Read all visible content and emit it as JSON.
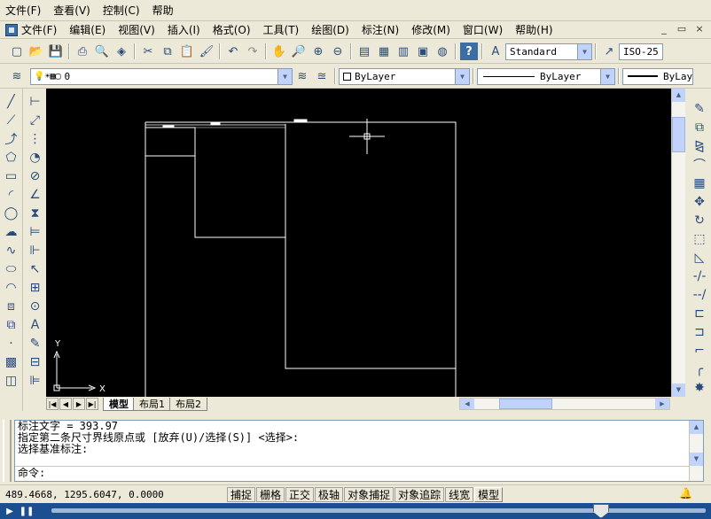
{
  "outer_menu": [
    "文件(F)",
    "查看(V)",
    "控制(C)",
    "帮助"
  ],
  "inner_menu": [
    "文件(F)",
    "编辑(E)",
    "视图(V)",
    "插入(I)",
    "格式(O)",
    "工具(T)",
    "绘图(D)",
    "标注(N)",
    "修改(M)",
    "窗口(W)",
    "帮助(H)"
  ],
  "window_controls": [
    "_",
    "▭",
    "×"
  ],
  "styles": {
    "text_style": "Standard",
    "dim_style": "ISO-25"
  },
  "layers": {
    "current_layer": "0",
    "color": "ByLayer",
    "linetype": "ByLayer",
    "lineweight": "ByLayer"
  },
  "tabs": [
    "模型",
    "布局1",
    "布局2"
  ],
  "ucs": {
    "x_label": "X",
    "y_label": "Y"
  },
  "command_window": {
    "lines": [
      "标注文字 = 393.97",
      "指定第二条尺寸界线原点或 [放弃(U)/选择(S)] <选择>:",
      "选择基准标注:"
    ],
    "prompt": "命令:"
  },
  "status": {
    "coords": "489.4668, 1295.6047, 0.0000",
    "buttons": [
      "捕捉",
      "栅格",
      "正交",
      "极轴",
      "对象捕捉",
      "对象追踪",
      "线宽",
      "模型"
    ]
  },
  "colors": {
    "canvas": "#000000",
    "lines": "#ffffff",
    "player": "#1c4f91"
  },
  "player": {
    "progress": 0.84
  }
}
